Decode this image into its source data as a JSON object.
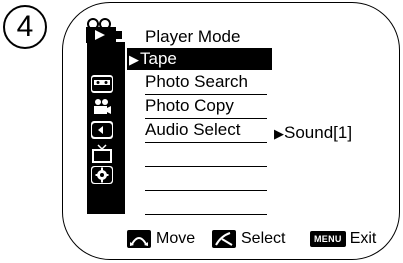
{
  "step": {
    "number": "4"
  },
  "menu": {
    "title": "Player Mode",
    "selected": "Tape",
    "items": [
      {
        "label": "Photo Search"
      },
      {
        "label": "Photo Copy"
      },
      {
        "label": "Audio Select"
      }
    ],
    "submenu_value": "Sound[1]"
  },
  "sidebar": {
    "icons": [
      "camcorder-icon",
      "tape-icon",
      "camera-icon",
      "memory-card-icon",
      "tv-icon",
      "settings-icon"
    ]
  },
  "footer": {
    "move_label": "Move",
    "select_label": "Select",
    "menu_key": "MENU",
    "exit_label": "Exit"
  }
}
